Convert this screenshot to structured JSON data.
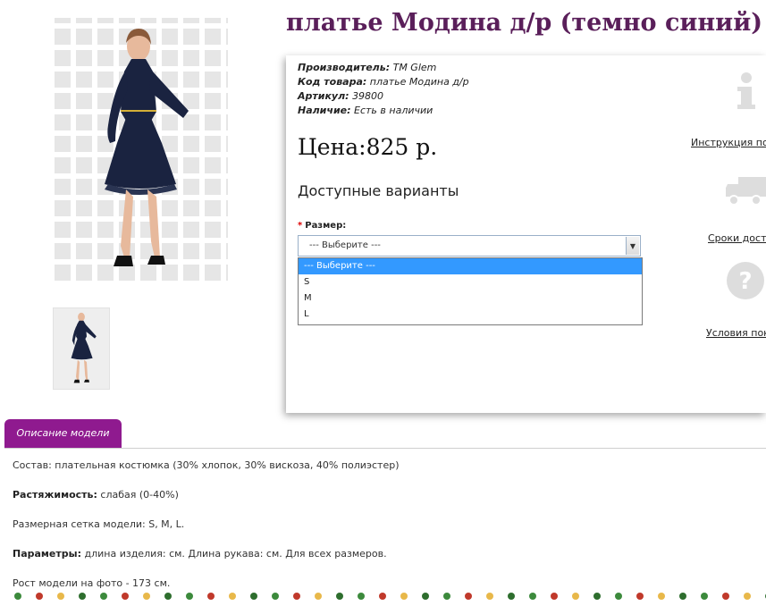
{
  "product": {
    "title": "платье Модина д/р (темно синий)",
    "meta": [
      {
        "label": "Производитель:",
        "value": "TM Glem"
      },
      {
        "label": "Код товара:",
        "value": "платье Модина д/р"
      },
      {
        "label": "Артикул:",
        "value": "39800"
      },
      {
        "label": "Наличие:",
        "value": "Есть в наличии"
      }
    ],
    "price": "Цена:825 р.",
    "variants_title": "Доступные варианты",
    "size_label": "Размер:",
    "size_required_mark": "*",
    "size_selected": "--- Выберите ---",
    "size_options": [
      "--- Выберите ---",
      "S",
      "M",
      "L"
    ]
  },
  "side_links": {
    "instruction": "Инструкция по",
    "delivery": "Сроки доста",
    "conditions": "Условия поку"
  },
  "icons": {
    "info": "info-icon",
    "truck": "truck-icon",
    "question": "question-icon",
    "dropdown_arrow": "▼"
  },
  "tab": {
    "label": "Описание модели"
  },
  "description": [
    {
      "label": "",
      "text": "Состав: плательная костюмка (30% хлопок, 30% вискоза, 40% полиэстер)"
    },
    {
      "label": "Растяжимость:",
      "text": " слабая (0-40%)"
    },
    {
      "label": "",
      "text": "Размерная сетка модели: S, M, L."
    },
    {
      "label": "Параметры:",
      "text": " длина изделия: см. Длина рукава: см. Для всех размеров."
    },
    {
      "label": "",
      "text": "Рост модели на фото - 173 см."
    }
  ],
  "colors": {
    "title": "#5a1f5a",
    "tab": "#8f1a8f",
    "dress": "#1a2340",
    "selected_option": "#3399ff",
    "icon_gray": "#dddddd"
  }
}
